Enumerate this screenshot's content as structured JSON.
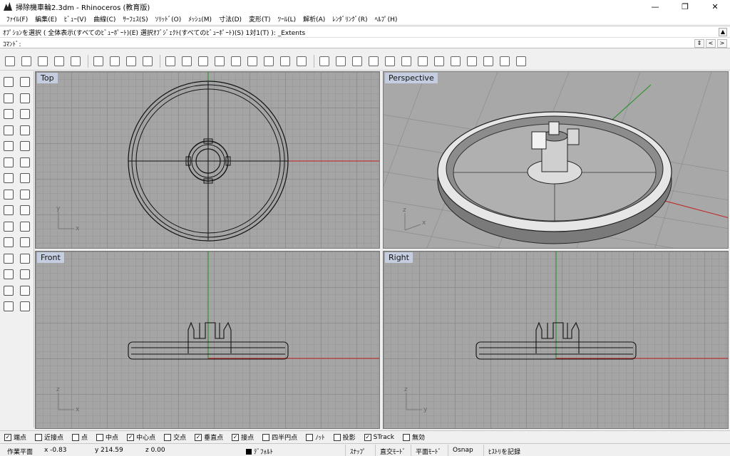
{
  "window": {
    "title": "掃除機車輪2.3dm - Rhinoceros (教育版)",
    "minimize": "—",
    "maximize": "❐",
    "close": "✕"
  },
  "menubar": {
    "items": [
      "ﾌｧｲﾙ(F)",
      "編集(E)",
      "ﾋﾞｭｰ(V)",
      "曲線(C)",
      "ｻｰﾌｪｽ(S)",
      "ｿﾘｯﾄﾞ(O)",
      "ﾒｯｼｭ(M)",
      "寸法(D)",
      "変形(T)",
      "ﾂｰﾙ(L)",
      "解析(A)",
      "ﾚﾝﾀﾞﾘﾝｸﾞ(R)",
      "ﾍﾙﾌﾟ(H)"
    ]
  },
  "command": {
    "history": "ｵﾌﾟｼｮﾝを選択 ( 全体表示(すべてのﾋﾞｭｰﾎﾟｰﾄ)(E)  選択ｵﾌﾞｼﾞｪｸﾄ(すべてのﾋﾞｭｰﾎﾟｰﾄ)(S)  1対1(T) ): _Extents",
    "prompt_label": "ｺﾏﾝﾄﾞ:",
    "ctrl_spin": "⇕",
    "ctrl_prev": "<",
    "ctrl_next": ">",
    "scroll_up": "▲"
  },
  "toolbar": {
    "icons": [
      "new-file-icon",
      "open-folder-icon",
      "save-icon",
      "print-icon",
      "import-icon",
      "cut-icon",
      "copy-icon",
      "paste-icon",
      "undo-icon",
      "pan-hand-icon",
      "rotate-view-icon",
      "zoom-icon",
      "zoom-window-icon",
      "zoom-extents-icon",
      "zoom-selected-icon",
      "undo-view-icon",
      "four-viewports-icon",
      "car-icon",
      "plane-icon",
      "select-icon",
      "lightbulb-icon",
      "lock-icon",
      "layer-icon",
      "color-wheel-icon",
      "render-sphere-icon",
      "grid-icon",
      "material-sphere-icon",
      "flag-icon",
      "gear-plugin-icon",
      "options-icon",
      "help-icon"
    ]
  },
  "lefttools": {
    "icons": [
      "select-arrow-icon",
      "point-icon",
      "polyline-icon",
      "curve-icon",
      "circle-icon",
      "ellipse-icon",
      "arc-icon",
      "rectangle-icon",
      "polygon-icon",
      "fillet-curve-icon",
      "offset-icon",
      "surface-edge-icon",
      "box-icon",
      "sphere-icon",
      "cylinder-icon",
      "extrude-icon",
      "boolean-icon",
      "explode-icon",
      "trim-icon",
      "split-icon",
      "join-icon",
      "group-icon",
      "move-icon",
      "rotate-icon",
      "text-icon",
      "array-icon",
      "block-icon",
      "mirror-icon",
      "mesh-icon",
      "dimension-icon"
    ]
  },
  "viewports": {
    "top": "Top",
    "perspective": "Perspective",
    "front": "Front",
    "right": "Right",
    "axis_x": "x",
    "axis_y": "y",
    "axis_z": "z"
  },
  "osnap": {
    "items": [
      {
        "label": "端点",
        "checked": true
      },
      {
        "label": "近接点",
        "checked": false
      },
      {
        "label": "点",
        "checked": false
      },
      {
        "label": "中点",
        "checked": false
      },
      {
        "label": "中心点",
        "checked": true
      },
      {
        "label": "交点",
        "checked": false
      },
      {
        "label": "垂直点",
        "checked": true
      },
      {
        "label": "接点",
        "checked": true
      },
      {
        "label": "四半円点",
        "checked": false
      },
      {
        "label": "ﾉｯﾄ",
        "checked": false
      },
      {
        "label": "投影",
        "checked": false
      },
      {
        "label": "STrack",
        "checked": true
      },
      {
        "label": "無効",
        "checked": false
      }
    ]
  },
  "status": {
    "cplane": "作業平面",
    "x": "x -0.83",
    "y": "y 214.59",
    "z": "z 0.00",
    "layer": "ﾃﾞﾌｫﾙﾄ",
    "snap": "ｽﾅｯﾌﾟ",
    "ortho": "直交ﾓｰﾄﾞ",
    "planar": "平面ﾓｰﾄﾞ",
    "osnap": "Osnap",
    "history": "ﾋｽﾄﾘを記録"
  },
  "colors": {
    "x_axis": "#c02020",
    "y_axis": "#209020",
    "viewport_bg": "#a5a5a5",
    "label_bg": "#c4cee0"
  }
}
